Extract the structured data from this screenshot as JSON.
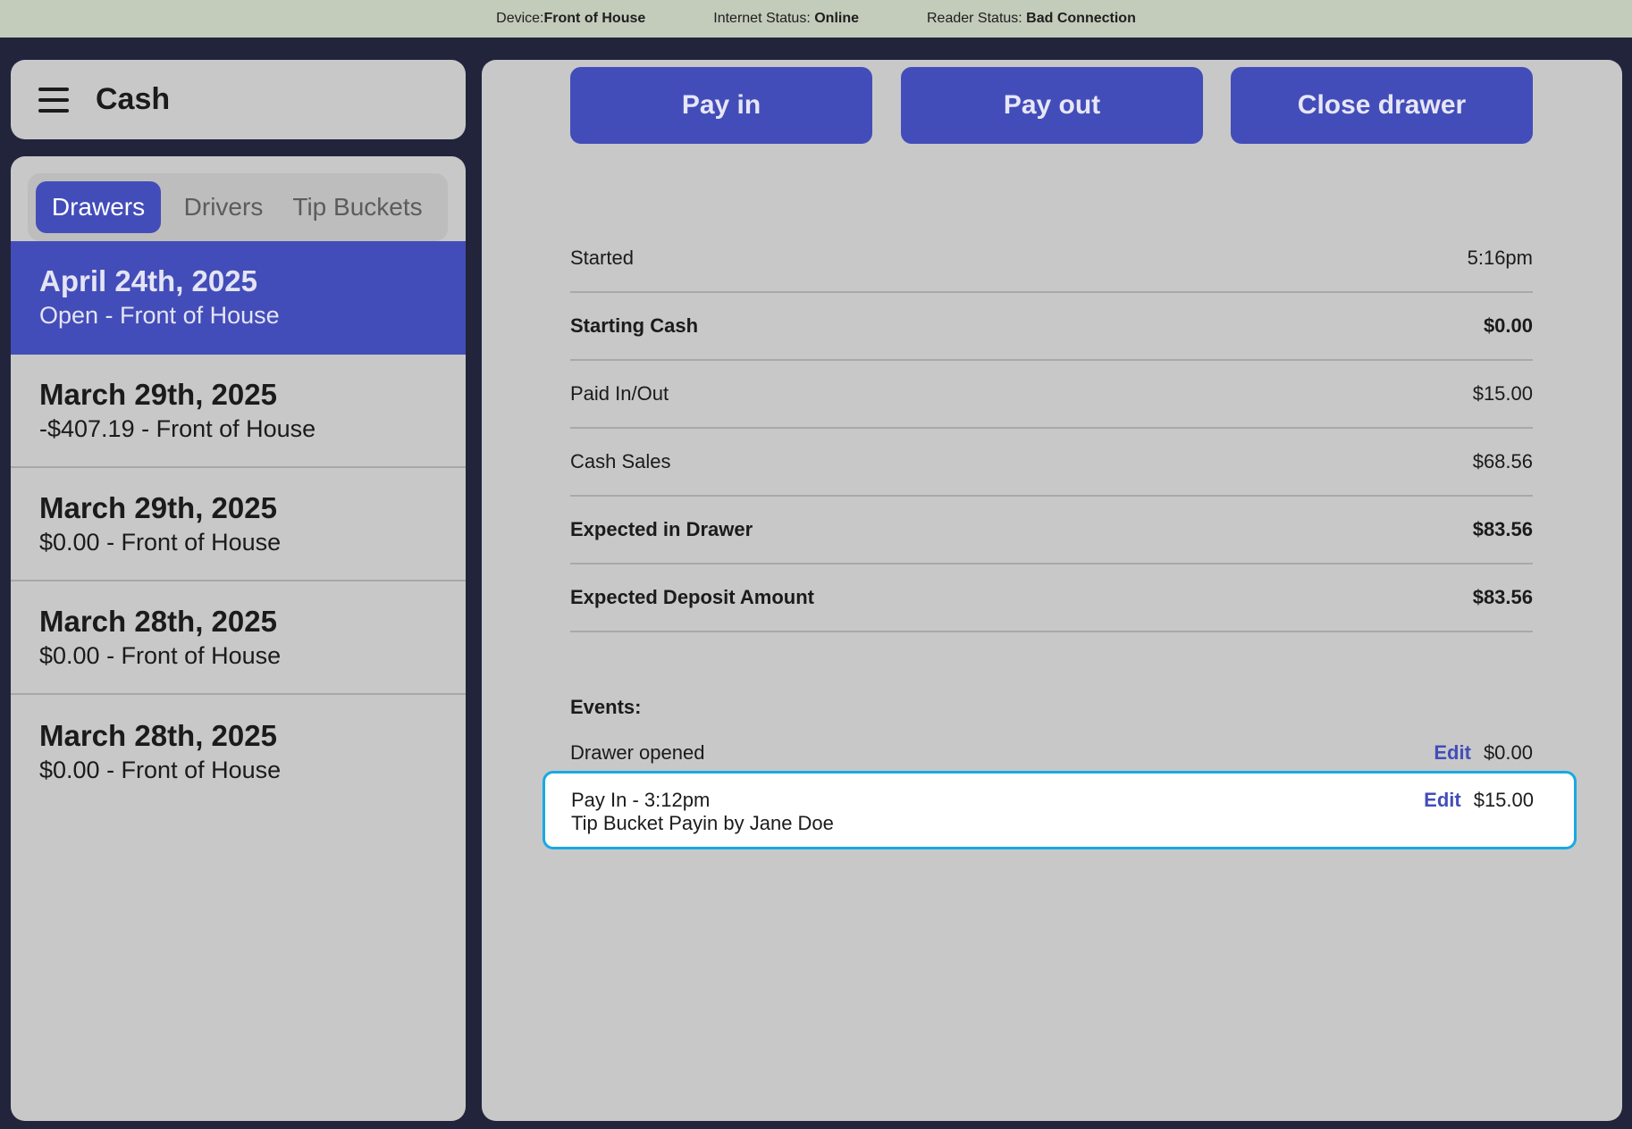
{
  "status_bar": {
    "device_label": "Device:",
    "device_value": "Front of House",
    "internet_label": "Internet Status: ",
    "internet_value": "Online",
    "reader_label": "Reader Status: ",
    "reader_value": "Bad Connection"
  },
  "sidebar": {
    "title": "Cash",
    "menu_icon": "hamburger-menu-icon",
    "tabs": [
      {
        "label": "Drawers",
        "active": true
      },
      {
        "label": "Drivers",
        "active": false
      },
      {
        "label": "Tip Buckets",
        "active": false
      }
    ],
    "drawers": [
      {
        "date": "April 24th, 2025",
        "subtitle": "Open - Front of House",
        "selected": true
      },
      {
        "date": "March 29th, 2025",
        "subtitle": "-$407.19 - Front of House",
        "selected": false
      },
      {
        "date": "March 29th, 2025",
        "subtitle": "$0.00 - Front of House",
        "selected": false
      },
      {
        "date": "March 28th, 2025",
        "subtitle": "$0.00 - Front of House",
        "selected": false
      },
      {
        "date": "March 28th, 2025",
        "subtitle": "$0.00 - Front of House",
        "selected": false
      }
    ]
  },
  "actions": {
    "pay_in": "Pay in",
    "pay_out": "Pay out",
    "close_drawer": "Close drawer"
  },
  "summary": [
    {
      "label": "Started",
      "value": "5:16pm",
      "bold": false
    },
    {
      "label": "Starting Cash",
      "value": "$0.00",
      "bold": true
    },
    {
      "label": "Paid In/Out",
      "value": "$15.00",
      "bold": false
    },
    {
      "label": "Cash Sales",
      "value": "$68.56",
      "bold": false
    },
    {
      "label": "Expected in Drawer",
      "value": "$83.56",
      "bold": true
    },
    {
      "label": "Expected Deposit Amount",
      "value": "$83.56",
      "bold": true
    }
  ],
  "events": {
    "label": "Events:",
    "items": [
      {
        "title": "Drawer opened",
        "detail": "",
        "edit_label": "Edit",
        "amount": "$0.00",
        "highlighted": false
      },
      {
        "title": "Pay In - 3:12pm",
        "detail": "Tip Bucket Payin by Jane Doe",
        "edit_label": "Edit",
        "amount": "$15.00",
        "highlighted": true
      }
    ]
  },
  "colors": {
    "accent": "#434db9",
    "highlight_border": "#17a9e3",
    "status_bar": "#c3cbbb",
    "background": "#22243c",
    "panel": "#c8c8c8"
  }
}
